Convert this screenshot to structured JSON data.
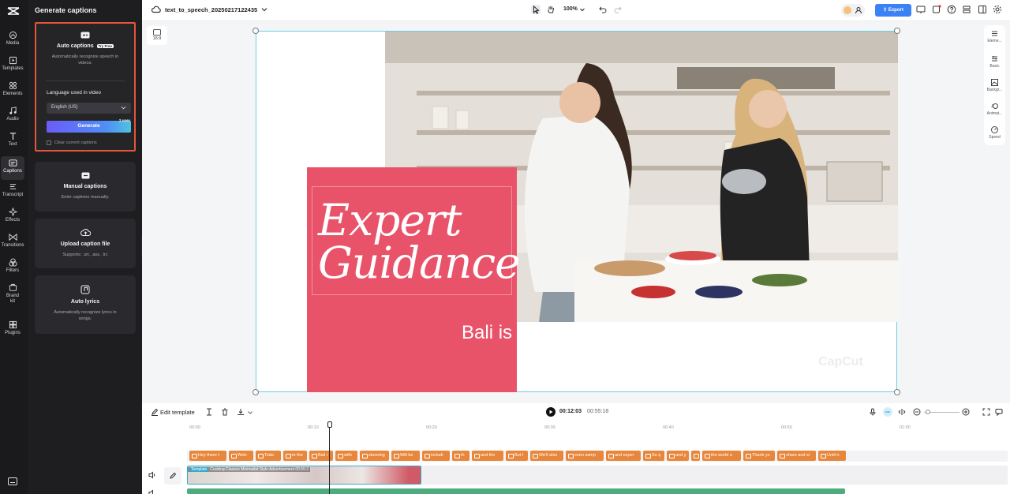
{
  "rail": {
    "items": [
      {
        "label": "Media",
        "icon": "media-icon"
      },
      {
        "label": "Templates",
        "icon": "templates-icon"
      },
      {
        "label": "Elements",
        "icon": "elements-icon"
      },
      {
        "label": "Audio",
        "icon": "audio-icon"
      },
      {
        "label": "Text",
        "icon": "text-icon"
      },
      {
        "label": "Captions",
        "icon": "captions-icon"
      },
      {
        "label": "Transcript",
        "icon": "transcript-icon"
      },
      {
        "label": "Effects",
        "icon": "effects-icon"
      },
      {
        "label": "Transitions",
        "icon": "transitions-icon"
      },
      {
        "label": "Filters",
        "icon": "filters-icon"
      },
      {
        "label": "Brand kit",
        "icon": "brand-kit-icon"
      },
      {
        "label": "Plugins",
        "icon": "plugins-icon"
      }
    ]
  },
  "panel": {
    "title": "Generate captions",
    "auto": {
      "title": "Auto captions",
      "badge": "Try Free",
      "desc": "Automatically recognize speech in videos.",
      "lang_label": "Language used in video",
      "lang_value": "English (US)",
      "generate": "Generate",
      "uses": "2 uses",
      "clear": "Clear current captions"
    },
    "manual": {
      "title": "Manual captions",
      "desc": "Enter captions manually."
    },
    "upload": {
      "title": "Upload caption file",
      "desc": "Supports: .srt, .ass, .lrc"
    },
    "lyrics": {
      "title": "Auto lyrics",
      "desc": "Automatically recognize lyrics in songs."
    }
  },
  "topbar": {
    "project_name": "text_to_speech_20250217122435",
    "zoom": "100%",
    "export": "Export"
  },
  "canvas": {
    "ratio": "16:9",
    "headline_1": "Expert",
    "headline_2": "Guidance",
    "subtitle": "Bali is",
    "watermark": "CapCut"
  },
  "right_rail": [
    {
      "label": "Eleme...",
      "icon": "elements-icon"
    },
    {
      "label": "Basic",
      "icon": "basic-icon"
    },
    {
      "label": "Backgr...",
      "icon": "background-icon"
    },
    {
      "label": "Animat...",
      "icon": "animation-icon"
    },
    {
      "label": "Speed",
      "icon": "speed-icon"
    }
  ],
  "timeline": {
    "edit_template": "Edit template",
    "current_time": "00:12:03",
    "total_time": "00:55:18",
    "ticks": [
      "00:00",
      "00:10",
      "00:20",
      "00:30",
      "00:40",
      "00:50",
      "01:00"
    ],
    "captions": [
      "Hey there t",
      "Welc",
      "Toda",
      "to the",
      "Bali i",
      "with",
      "stunning",
      "Will be",
      "includi",
      "th",
      "and the",
      "But I",
      "We'll also",
      "seen samp",
      "and exper",
      "So q",
      "and y",
      "g",
      "the world o",
      "Thank yo",
      "share and si",
      "Until n"
    ],
    "video_clip_tag": "Template",
    "video_clip_label": "Cooking Classes Minimalist Style Advertisement",
    "video_clip_time": "00:55:2"
  }
}
